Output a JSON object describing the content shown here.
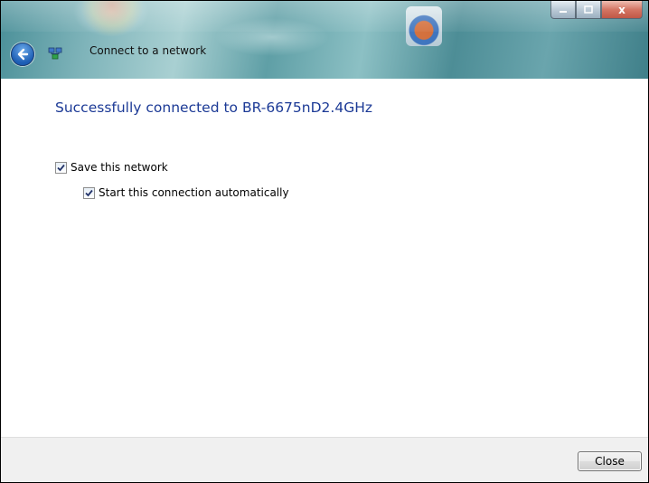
{
  "window": {
    "title": "Connect to a network",
    "controls": {
      "minimize": "minimize",
      "maximize": "maximize",
      "close": "x"
    },
    "back_icon": "back-arrow-icon",
    "network_icon": "network-icon"
  },
  "main": {
    "heading": "Successfully connected to BR-6675nD2.4GHz",
    "options": [
      {
        "label": "Save this network",
        "checked": true
      },
      {
        "label": "Start this connection automatically",
        "checked": true
      }
    ]
  },
  "footer": {
    "close_label": "Close"
  },
  "colors": {
    "heading": "#1c3a96",
    "footer_bg": "#f0f0f0",
    "titlebar_glass": "#6aa5ad"
  }
}
